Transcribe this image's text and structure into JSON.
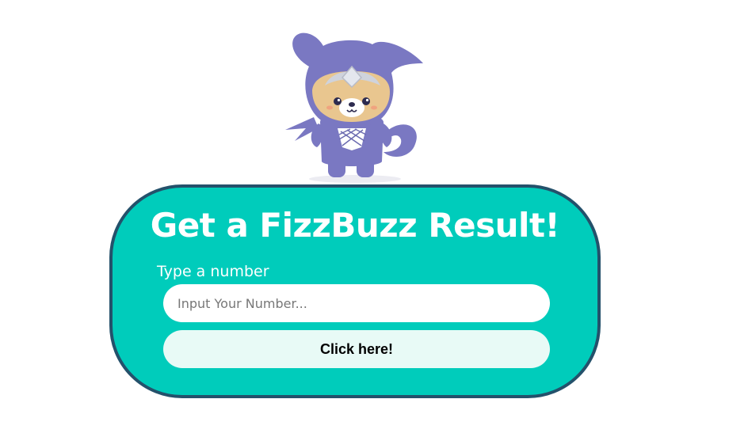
{
  "mascot": {
    "icon": "ninja-dog-mascot-icon",
    "colors": {
      "body": "#7a78c2",
      "face": "#e9c68f",
      "plate": "#cfd3dc"
    }
  },
  "card": {
    "title": "Get a FizzBuzz Result!",
    "input_label": "Type a number",
    "input_placeholder": "Input Your Number...",
    "input_value": "",
    "button_label": "Click here!"
  },
  "colors": {
    "card_background": "#00ccbb",
    "card_border": "#24516b",
    "button_background": "#e8faf6",
    "title_text": "#ffffff"
  }
}
